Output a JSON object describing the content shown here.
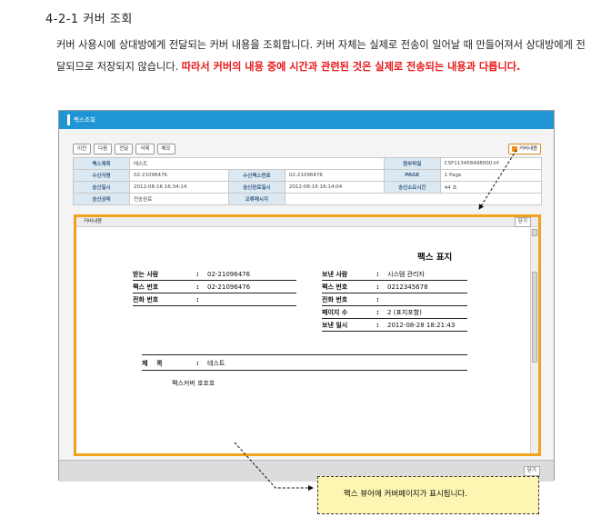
{
  "heading": "4-2-1  커버 조회",
  "paragraph": {
    "normal": "커버 사용시에 상대방에게 전달되는 커버 내용을 조회합니다. 커버 자체는 실제로 전송이 일어날 때 만들어져서 상대방에게 전달되므로 저장되지 않습니다. ",
    "highlight": "따라서 커버의 내용 중에 시간과 관련된 것은 실제로 전송되는 내용과 다릅니다."
  },
  "screen": {
    "title": "팩스조회",
    "toolbar": [
      "이전",
      "다음",
      "전달",
      "삭제",
      "메모"
    ],
    "cover_button": "커버내용",
    "info_rows": [
      [
        {
          "l": "팩스제목",
          "v": "테스트"
        },
        {
          "l": "",
          "v": ""
        },
        {
          "l": "첨부파일",
          "v": "CSF113458498000.tif"
        }
      ],
      [
        {
          "l": "수신자명",
          "v": "02-21096476"
        },
        {
          "l": "수신팩스번호",
          "v": "02-21096476"
        },
        {
          "l": "PAGE",
          "v": "1 Page"
        }
      ],
      [
        {
          "l": "송신일시",
          "v": "2012-08-16 16:34:14"
        },
        {
          "l": "송신완료일시",
          "v": "2012-08-16 16:14:04"
        },
        {
          "l": "송신소요시간",
          "v": "44 초"
        }
      ],
      [
        {
          "l": "송신상태",
          "v": "전송완료"
        },
        {
          "l": "오류메시지",
          "v": ""
        },
        {
          "l": "",
          "v": ""
        }
      ]
    ],
    "content_label": "커버내용",
    "content_button": "닫기",
    "footer_button": "닫기",
    "fax": {
      "title": "팩스 표지",
      "to_label": "받는 사람",
      "to_value": "02-21096476",
      "from_label": "보낸 사람",
      "from_value": "시스템 관리자",
      "tofax_label": "팩스 번호",
      "tofax_value": "02-21096476",
      "fromfax_label": "팩스 번호",
      "fromfax_value": "0212345678",
      "tophone_label": "전화 번호",
      "tophone_value": "",
      "fromphone_label": "전화 번호",
      "fromphone_value": "",
      "pages_label": "페이지 수",
      "pages_value": "2 (표지포함)",
      "sent_label": "보낸 일시",
      "sent_value": "2012-08-28 18:21:43",
      "subject_label": "제    목",
      "subject_value": "테스트",
      "body": "팩스커버 호호호"
    }
  },
  "callout": "팩스 뷰어에 커버페이지가 표시됩니다.",
  "colors": {
    "titlebar": "#1f95d6",
    "highlight_box": "#f2a21b",
    "red_text": "#e8191b",
    "callout_bg": "#fdf6b2"
  }
}
